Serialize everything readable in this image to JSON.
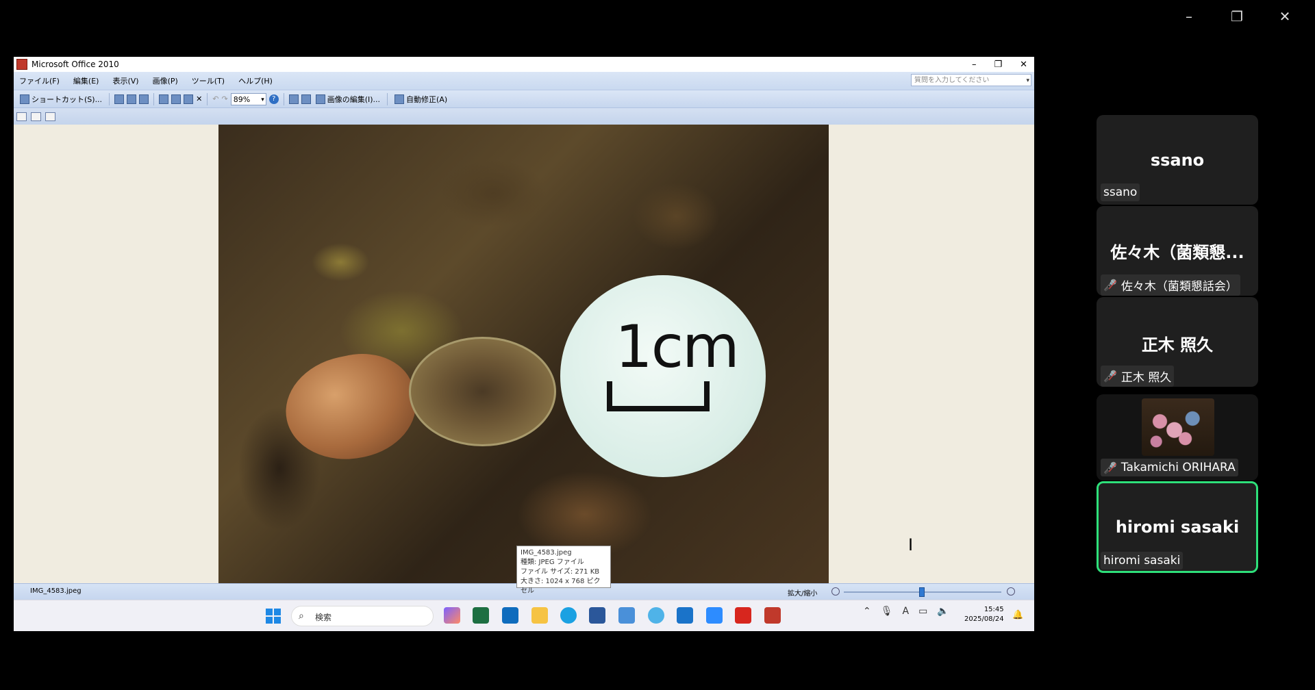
{
  "meeting": {
    "window_controls": [
      "–",
      "❐",
      "✕"
    ]
  },
  "office": {
    "title": "Microsoft Office 2010",
    "menu": [
      "ファイル(F)",
      "編集(E)",
      "表示(V)",
      "画像(P)",
      "ツール(T)",
      "ヘルプ(H)"
    ],
    "help_placeholder": "質問を入力してください",
    "toolbar": {
      "shortcut": "ショートカット(S)...",
      "zoom": "89%",
      "edit_image": "画像の編集(I)...",
      "auto_correct": "自動修正(A)"
    },
    "photo": {
      "scale_label": "1cm"
    },
    "status": {
      "filename": "IMG_4583.jpeg",
      "zoom_label": "拡大/縮小",
      "zoom_level": 0.48
    },
    "tooltip": {
      "lines": [
        "IMG_4583.jpeg",
        "種類: JPEG ファイル",
        "ファイル サイズ: 271 KB",
        "大きさ: 1024 x 768 ピクセル"
      ]
    },
    "taskbar": {
      "search_label": "検索",
      "time": "15:45",
      "date": "2025/08/24"
    }
  },
  "participants": [
    {
      "big_name": "ssano",
      "label": "ssano",
      "muted": false,
      "active": false
    },
    {
      "big_name": "佐々木（菌類懇...",
      "label": "佐々木（菌類懇話会）",
      "muted": true,
      "active": false
    },
    {
      "big_name": "正木 照久",
      "label": "正木 照久",
      "muted": true,
      "active": false
    },
    {
      "big_name": "",
      "label": "Takamichi ORIHARA",
      "muted": true,
      "active": false,
      "has_video": true
    },
    {
      "big_name": "hiromi sasaki",
      "label": "hiromi sasaki",
      "muted": false,
      "active": true
    }
  ],
  "colors": {
    "active_speaker": "#2ee07a",
    "muted_icon": "#e53935"
  }
}
